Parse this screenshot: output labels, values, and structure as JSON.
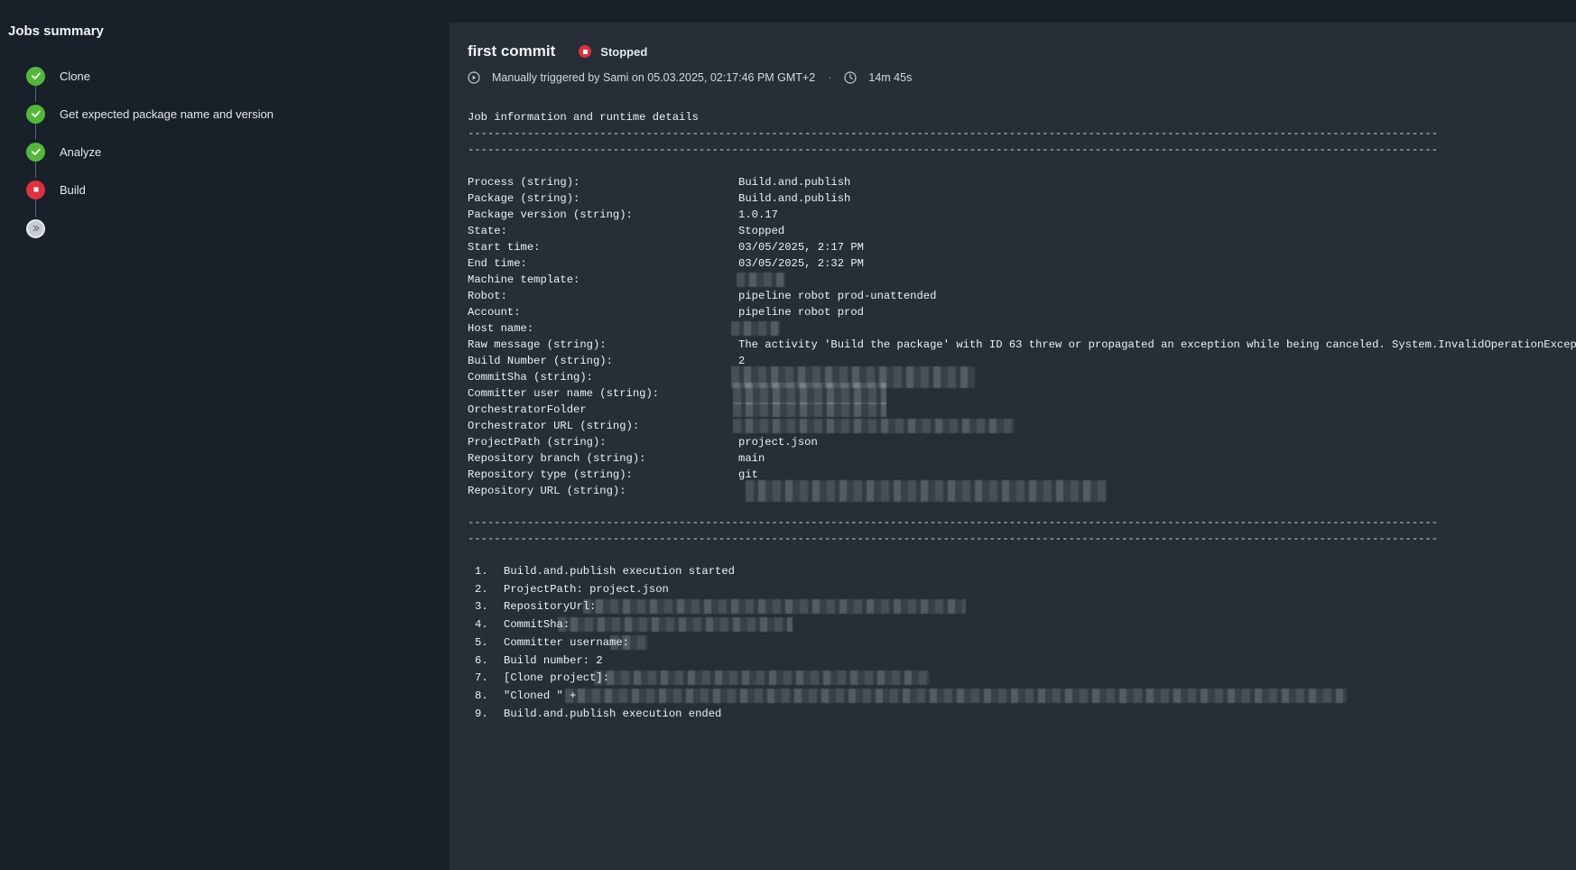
{
  "sidebar": {
    "title": "Jobs summary",
    "steps": [
      {
        "label": "Clone",
        "status": "success"
      },
      {
        "label": "Get expected package name and version",
        "status": "success"
      },
      {
        "label": "Analyze",
        "status": "success"
      },
      {
        "label": "Build",
        "status": "stopped"
      },
      {
        "label": "",
        "status": "pending"
      }
    ]
  },
  "header": {
    "title": "first commit",
    "status": "Stopped",
    "trigger_text": "Manually triggered by Sami on 05.03.2025, 02:17:46 PM GMT+2",
    "duration": "14m 45s"
  },
  "log": {
    "heading": "Job information and runtime details",
    "separator": "---------------------------------------------------------------------------------------------------------------------------------------------------",
    "fields": [
      {
        "key": "Process (string):",
        "value": "Build.and.publish"
      },
      {
        "key": "Package (string):",
        "value": "Build.and.publish"
      },
      {
        "key": "Package version (string):",
        "value": "1.0.17"
      },
      {
        "key": "State:",
        "value": "Stopped"
      },
      {
        "key": "Start time:",
        "value": "03/05/2025, 2:17 PM"
      },
      {
        "key": "End time:",
        "value": "03/05/2025, 2:32 PM"
      },
      {
        "key": "Machine template:",
        "value": ""
      },
      {
        "key": "Robot:",
        "value": "pipeline robot prod-unattended"
      },
      {
        "key": "Account:",
        "value": "pipeline robot prod"
      },
      {
        "key": "Host name:",
        "value": ""
      },
      {
        "key": "Raw message (string):",
        "value": "The activity 'Build the package' with ID 63 threw or propagated an exception while being canceled. System.InvalidOperationException:"
      },
      {
        "key": "Build Number (string):",
        "value": "2"
      },
      {
        "key": "CommitSha (string):",
        "value": ""
      },
      {
        "key": "Committer user name (string):",
        "value": ""
      },
      {
        "key": "OrchestratorFolder",
        "value": ""
      },
      {
        "key": "Orchestrator URL (string):",
        "value": ""
      },
      {
        "key": "ProjectPath (string):",
        "value": "project.json"
      },
      {
        "key": "Repository branch (string):",
        "value": "main"
      },
      {
        "key": "Repository type (string):",
        "value": "git"
      },
      {
        "key": "Repository URL (string):",
        "value": ""
      }
    ],
    "steps": [
      {
        "num": "1.",
        "text": "Build.and.publish execution started"
      },
      {
        "num": "2.",
        "text": "ProjectPath: project.json"
      },
      {
        "num": "3.",
        "text": "RepositoryUrl:"
      },
      {
        "num": "4.",
        "text": "CommitSha:"
      },
      {
        "num": "5.",
        "text": "Committer username:"
      },
      {
        "num": "6.",
        "text": "Build number: 2"
      },
      {
        "num": "7.",
        "text": "[Clone project]:"
      },
      {
        "num": "8.",
        "text": "\"Cloned \" +"
      },
      {
        "num": "9.",
        "text": "Build.and.publish execution ended"
      }
    ]
  },
  "colors": {
    "success": "#52b83a",
    "stopped": "#e0303e",
    "panel": "#272e37",
    "background": "#18202a"
  }
}
